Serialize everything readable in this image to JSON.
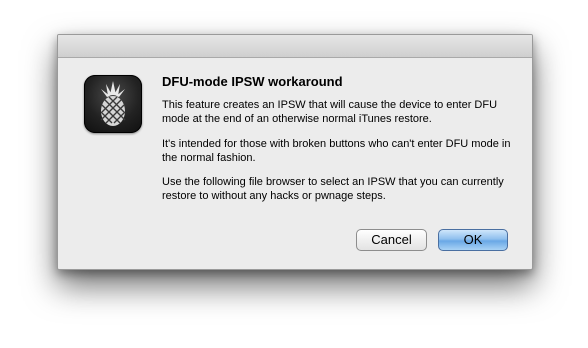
{
  "dialog": {
    "icon": "pineapple-icon",
    "title": "DFU-mode IPSW workaround",
    "paragraphs": [
      "This feature creates an IPSW that will cause the device to enter DFU mode at the end of an otherwise normal iTunes restore.",
      "It's intended for those with broken buttons who can't enter DFU mode in the normal fashion.",
      "Use the following file browser to select an IPSW that you can currently restore to without any hacks or pwnage steps."
    ],
    "buttons": {
      "cancel": "Cancel",
      "ok": "OK"
    }
  }
}
